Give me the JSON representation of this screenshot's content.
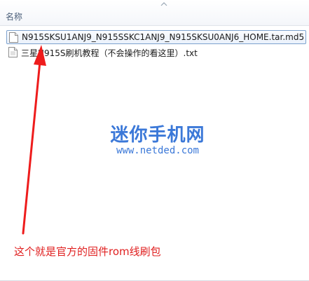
{
  "list": {
    "column_header": "名称",
    "files": [
      {
        "name": "N915SKSU1ANJ9_N915SSKC1ANJ9_N915SKSU0ANJ6_HOME.tar.md5",
        "icon": "file-icon",
        "selected": true
      },
      {
        "name": "三星N915S刷机教程（不会操作的看这里）.txt",
        "icon": "file-icon",
        "selected": false
      }
    ]
  },
  "watermark": {
    "brand": "迷你手机网",
    "url": "www.netded.com"
  },
  "annotation": {
    "text": "这个就是官方的固件rom线刷包"
  },
  "colors": {
    "selection_border": "#7da2ce",
    "watermark": "#3b78d8",
    "annotation": "#e02020"
  }
}
